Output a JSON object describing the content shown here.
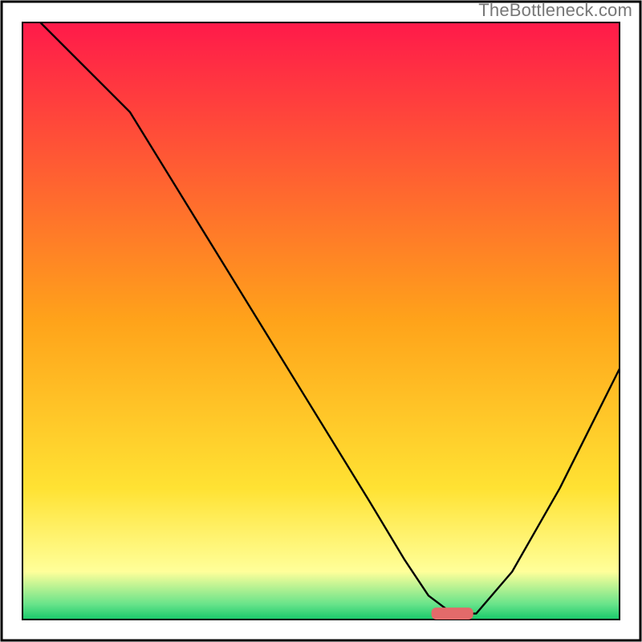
{
  "watermark": "TheBottleneck.com",
  "chart_data": {
    "type": "line",
    "title": "",
    "xlabel": "",
    "ylabel": "",
    "xlim": [
      0,
      100
    ],
    "ylim": [
      0,
      100
    ],
    "grid": false,
    "legend": false,
    "annotations": [],
    "background_gradient_stops": [
      {
        "offset": 0.0,
        "color": "#ff1a4a"
      },
      {
        "offset": 0.5,
        "color": "#ffa31a"
      },
      {
        "offset": 0.78,
        "color": "#ffe233"
      },
      {
        "offset": 0.92,
        "color": "#ffff9a"
      },
      {
        "offset": 0.975,
        "color": "#66e38a"
      },
      {
        "offset": 1.0,
        "color": "#17c96a"
      }
    ],
    "series": [
      {
        "name": "curve",
        "color": "#000000",
        "x": [
          3,
          10,
          18,
          26,
          34,
          42,
          50,
          58,
          64,
          68,
          72,
          76,
          82,
          90,
          100
        ],
        "y": [
          100,
          93,
          85,
          72,
          59,
          46,
          33,
          20,
          10,
          4,
          1,
          1,
          8,
          22,
          42
        ]
      }
    ],
    "marker": {
      "x": 72,
      "y": 1,
      "width": 7,
      "height": 2,
      "color": "#e36a6a"
    },
    "frames": {
      "outer": {
        "x": 0,
        "y": 0,
        "w": 100,
        "h": 100,
        "stroke": "#000000"
      },
      "inner": {
        "x": 3.3,
        "y": 3.3,
        "w": 93.4,
        "h": 93.4,
        "stroke": "#000000"
      }
    }
  }
}
